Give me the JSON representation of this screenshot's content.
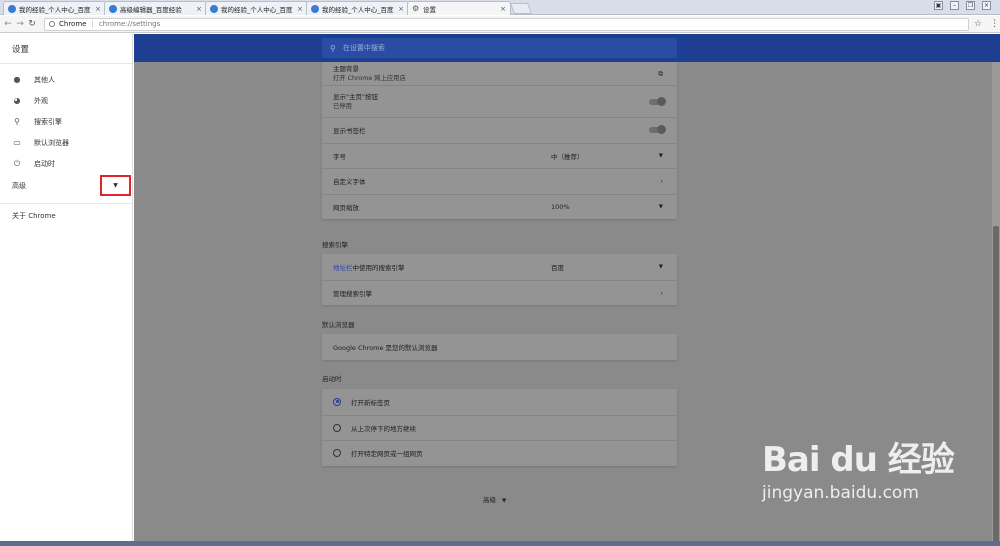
{
  "tabs": [
    {
      "title": "我的经验_个人中心_百度",
      "icon": "baidu-paw-icon"
    },
    {
      "title": "高级编辑器_百度经验",
      "icon": "baidu-paw-icon"
    },
    {
      "title": "我的经验_个人中心_百度",
      "icon": "baidu-paw-icon"
    },
    {
      "title": "我的经验_个人中心_百度",
      "icon": "baidu-paw-icon"
    },
    {
      "title": "设置",
      "icon": "gear-icon",
      "active": true
    }
  ],
  "toolbar": {
    "origin": "Chrome",
    "path": "chrome://settings"
  },
  "sidebar": {
    "title": "设置",
    "items": [
      {
        "label": "其他人",
        "icon": "person-icon"
      },
      {
        "label": "外观",
        "icon": "palette-icon"
      },
      {
        "label": "搜索引擎",
        "icon": "search-icon"
      },
      {
        "label": "默认浏览器",
        "icon": "browser-icon"
      },
      {
        "label": "启动时",
        "icon": "power-icon"
      }
    ],
    "advanced": "高级",
    "about": "关于 Chrome"
  },
  "search": {
    "placeholder": "在设置中搜索"
  },
  "appearance": {
    "theme_title": "主题背景",
    "theme_sub": "打开 Chrome 网上应用店",
    "home_title": "显示\"主页\"按钮",
    "home_sub": "已停用",
    "bookmarks": "显示书签栏",
    "font_size_label": "字号",
    "font_size_value": "中（推荐）",
    "custom_fonts": "自定义字体",
    "zoom_label": "网页缩放",
    "zoom_value": "100%"
  },
  "search_engine": {
    "section": "搜索引擎",
    "link": "地址栏",
    "label_suffix": "中使用的搜索引擎",
    "value": "百度",
    "manage": "管理搜索引擎"
  },
  "default_browser": {
    "section": "默认浏览器",
    "text": "Google Chrome 是您的默认浏览器"
  },
  "startup": {
    "section": "启动时",
    "options": [
      {
        "label": "打开新标签页",
        "selected": true
      },
      {
        "label": "从上次停下的地方继续",
        "selected": false
      },
      {
        "label": "打开特定网页或一组网页",
        "selected": false
      }
    ]
  },
  "bottom_advanced": "高级",
  "watermark": {
    "logo": "Bai du 经验",
    "url": "jingyan.baidu.com"
  },
  "colors": {
    "header": "#1d3e91",
    "highlight_box": "#e0242c"
  }
}
